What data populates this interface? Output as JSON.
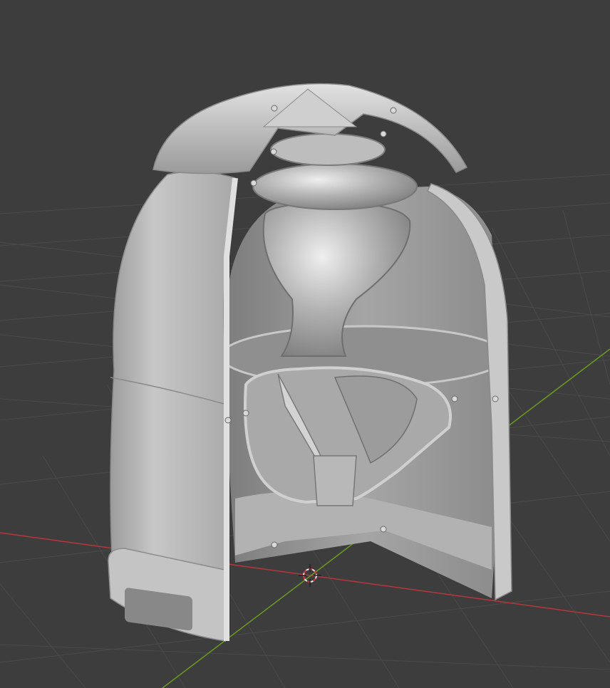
{
  "viewport": {
    "background": "#3d3d3d",
    "grid_color": "#4a4a4a",
    "x_axis_color": "#b8363c",
    "y_axis_color": "#6a9a20",
    "cursor_icon": "3d-cursor-icon",
    "model_color": "#b9b9b9"
  }
}
